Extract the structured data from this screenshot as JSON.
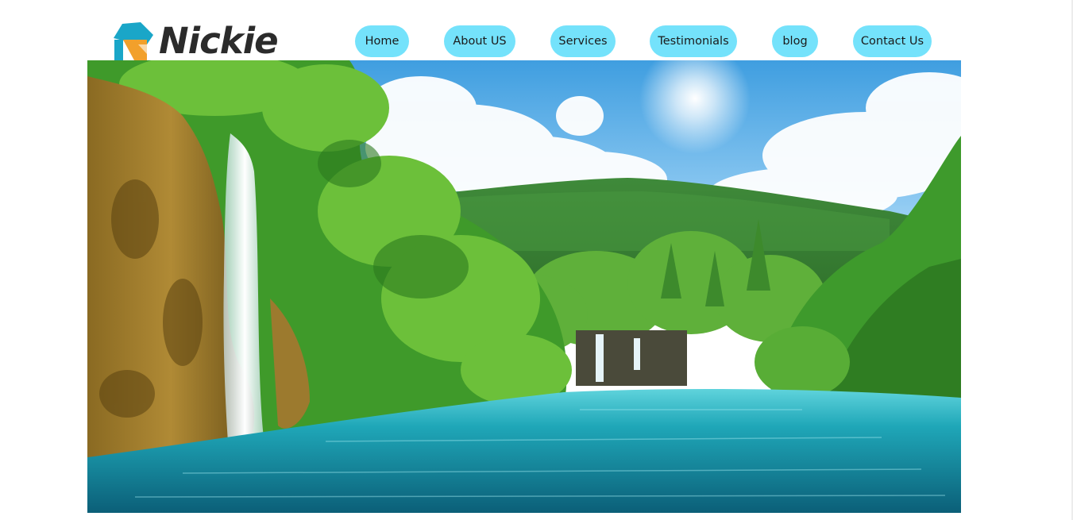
{
  "brand": {
    "name": "Nickie",
    "logo_icon": "n-logo-icon",
    "colors": {
      "teal": "#1aa6c8",
      "orange": "#f2a02b",
      "text": "#2b2b2b"
    }
  },
  "nav": {
    "color": "#74e2fb",
    "items": [
      {
        "label": "Home"
      },
      {
        "label": "About US"
      },
      {
        "label": "Services"
      },
      {
        "label": "Testimonials"
      },
      {
        "label": "blog"
      },
      {
        "label": "Contact Us"
      }
    ]
  },
  "hero": {
    "image": "waterfall-lake-landscape"
  }
}
